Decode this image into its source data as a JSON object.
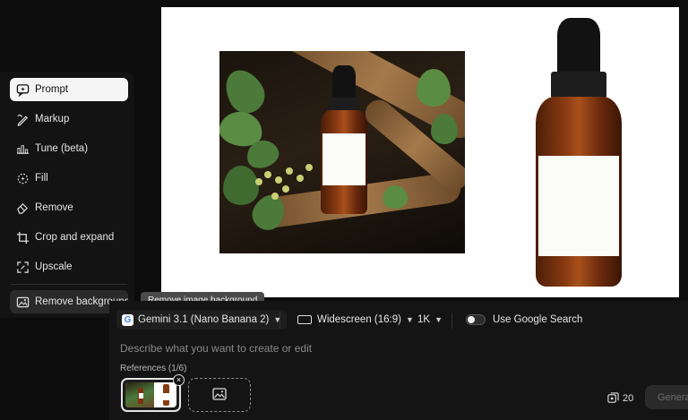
{
  "tools": [
    {
      "label": "Prompt",
      "icon": "prompt-icon"
    },
    {
      "label": "Markup",
      "icon": "markup-icon"
    },
    {
      "label": "Tune (beta)",
      "icon": "tune-icon"
    },
    {
      "label": "Fill",
      "icon": "fill-icon"
    },
    {
      "label": "Remove",
      "icon": "remove-icon"
    },
    {
      "label": "Crop and expand",
      "icon": "crop-icon"
    },
    {
      "label": "Upscale",
      "icon": "upscale-icon"
    },
    {
      "label": "Remove background",
      "icon": "remove-background-icon"
    }
  ],
  "tooltip": "Remove image background",
  "prompt_bar": {
    "model": "Gemini 3.1 (Nano Banana 2)",
    "model_icon_letter": "G",
    "aspect": "Widescreen (16:9)",
    "resolution": "1K",
    "google_search_label": "Use Google Search",
    "google_search_enabled": false,
    "placeholder": "Describe what you want to create or edit",
    "references_label": "References (1/6)",
    "credits": "20",
    "generate_label": "Generate"
  },
  "colors": {
    "background": "#0c0c0c",
    "panel": "#131313",
    "active_tool": "#f5f5f5"
  }
}
